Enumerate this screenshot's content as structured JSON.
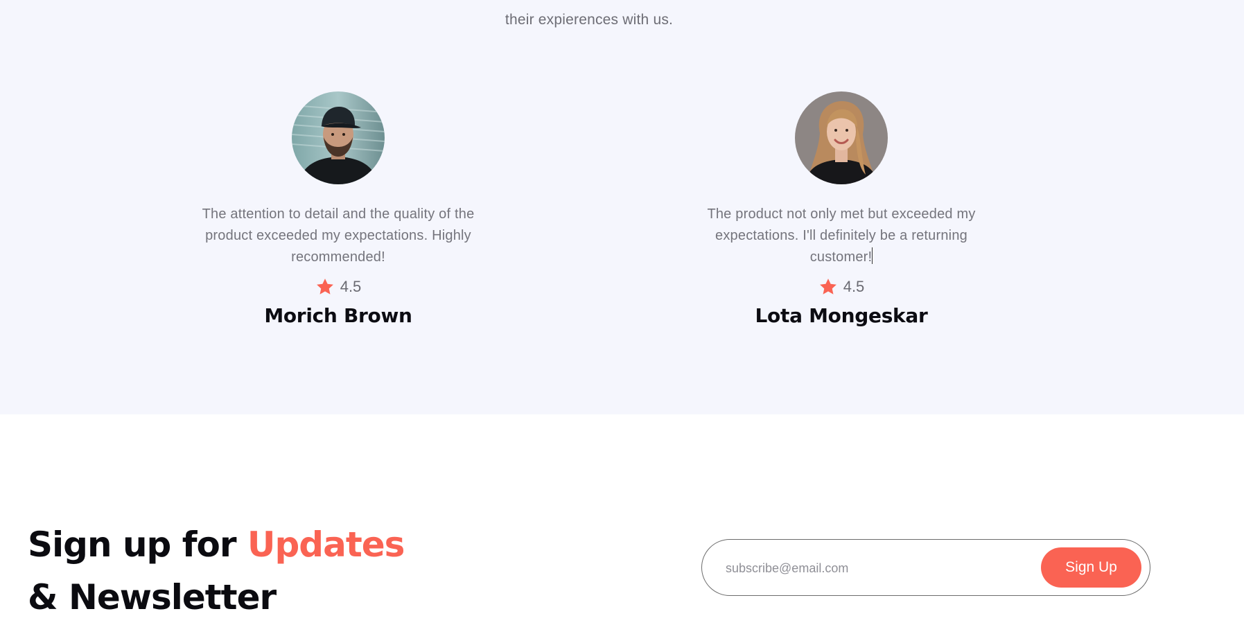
{
  "intro": {
    "text": "their expierences with us."
  },
  "testimonials": [
    {
      "quote": "The attention to detail and the quality of the product exceeded my expectations. Highly recommended!",
      "rating": "4.5",
      "name": "Morich Brown"
    },
    {
      "quote": "The product not only met but exceeded my expectations. I'll definitely be a returning customer!",
      "rating": "4.5",
      "name": "Lota Mongeskar"
    }
  ],
  "newsletter": {
    "heading_part1": "Sign up for ",
    "heading_accent": "Updates",
    "heading_line2": "& Newsletter",
    "email_placeholder": "subscribe@email.com",
    "email_value": "",
    "button_label": "Sign Up"
  },
  "colors": {
    "accent": "#fa6353",
    "section_bg": "#f5f6fd",
    "star": "#fa6353"
  },
  "icons": {
    "rating": "star-icon"
  }
}
